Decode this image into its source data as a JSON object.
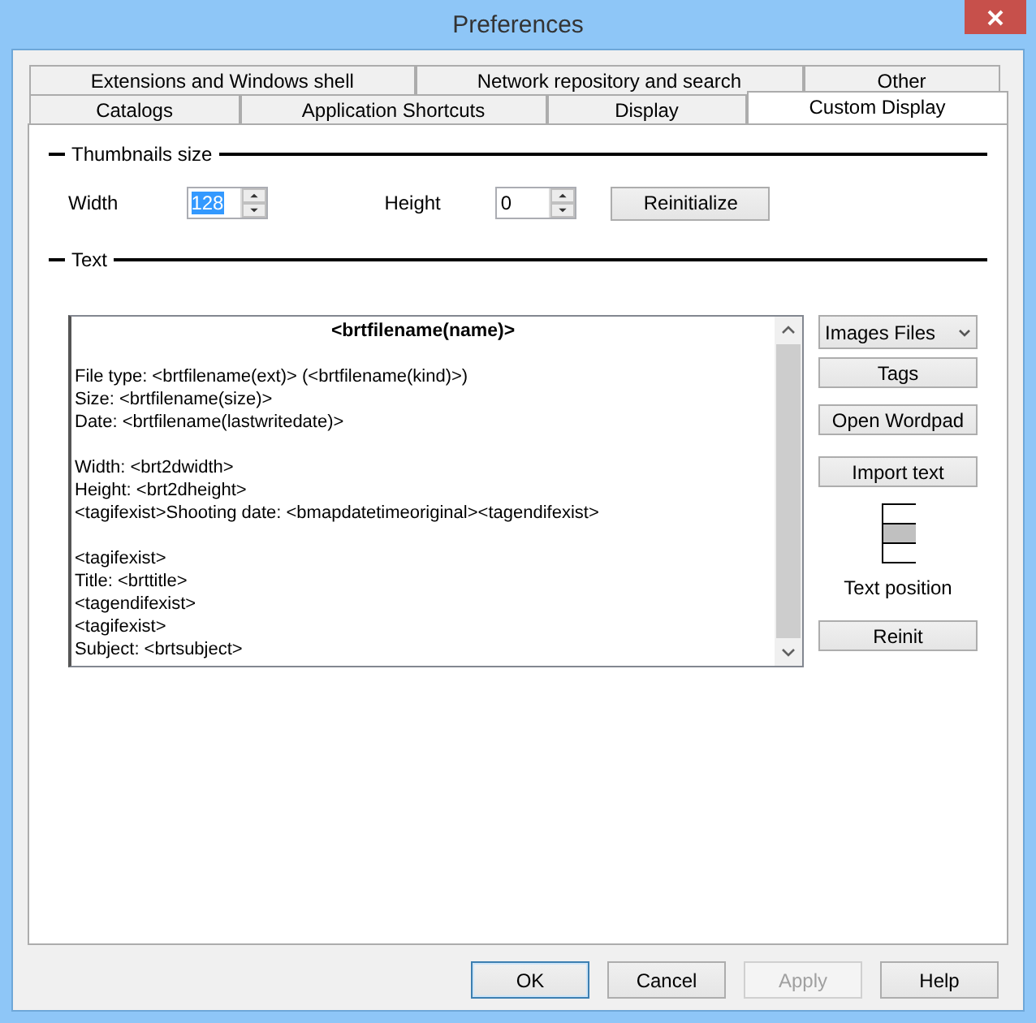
{
  "window": {
    "title": "Preferences"
  },
  "tab_rows": [
    [
      {
        "label": "Extensions and Windows shell",
        "selected": false
      },
      {
        "label": "Network repository and search",
        "selected": false
      },
      {
        "label": "Other",
        "selected": false
      }
    ],
    [
      {
        "label": "Catalogs",
        "selected": false
      },
      {
        "label": "Application Shortcuts",
        "selected": false
      },
      {
        "label": "Display",
        "selected": false
      },
      {
        "label": "Custom Display",
        "selected": true
      }
    ]
  ],
  "thumbnails_size": {
    "title": "Thumbnails size",
    "width_label": "Width",
    "width_value": "128",
    "width_value_selected": true,
    "height_label": "Height",
    "height_value": "0",
    "height_value_selected": false,
    "reinitialize_button": "Reinitialize"
  },
  "text_section": {
    "title": "Text",
    "editor_lines": [
      {
        "kind": "heading",
        "text": "<brtfilename(name)>"
      },
      {
        "kind": "blank"
      },
      {
        "kind": "line",
        "text": "File type: <brtfilename(ext)> (<brtfilename(kind)>)"
      },
      {
        "kind": "line",
        "text": "Size: <brtfilename(size)>"
      },
      {
        "kind": "line",
        "text": "Date: <brtfilename(lastwritedate)>"
      },
      {
        "kind": "blank"
      },
      {
        "kind": "line",
        "text": "Width: <brt2dwidth>"
      },
      {
        "kind": "line",
        "text": "Height: <brt2dheight>"
      },
      {
        "kind": "line",
        "text": "<tagifexist>Shooting date: <bmapdatetimeoriginal><tagendifexist>"
      },
      {
        "kind": "blank"
      },
      {
        "kind": "line",
        "text": "<tagifexist>"
      },
      {
        "kind": "line",
        "text": "Title: <brttitle>"
      },
      {
        "kind": "line",
        "text": "<tagendifexist>"
      },
      {
        "kind": "line",
        "text": "<tagifexist>"
      },
      {
        "kind": "line",
        "text": "Subject: <brtsubject>"
      }
    ],
    "file_type_dropdown": "Images Files",
    "buttons": [
      "Tags",
      "Open Wordpad",
      "Import text"
    ],
    "text_position": [
      {
        "selected": false
      },
      {
        "selected": true
      },
      {
        "selected": false
      }
    ],
    "text_position_label": "Text position",
    "reinit_button": "Reinit"
  },
  "dialog_buttons": [
    {
      "label": "OK",
      "default": true,
      "disabled": false
    },
    {
      "label": "Cancel",
      "default": false,
      "disabled": false
    },
    {
      "label": "Apply",
      "default": false,
      "disabled": true
    },
    {
      "label": "Help",
      "default": false,
      "disabled": false
    }
  ]
}
